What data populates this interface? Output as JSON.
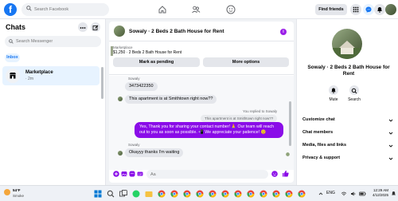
{
  "topbar": {
    "logo": "f",
    "search_placeholder": "Search Facebook",
    "find_friends": "Find friends"
  },
  "sidebar": {
    "title": "Chats",
    "search_placeholder": "Search Messenger",
    "inbox_label": "Inbox",
    "conversations": [
      {
        "name": "Marketplace",
        "time": "· 2m"
      }
    ]
  },
  "chat": {
    "title": "Sowaly · 2 Beds 2 Bath House for Rent",
    "info_icon": "i",
    "listing": {
      "label": "Marketplace",
      "description": "$1,250 · 2 Beds 2 Bath House for Rent",
      "mark_pending": "Mark as pending",
      "more_options": "More options"
    },
    "messages": {
      "sender1": "Sowaly",
      "msg1": "3473422350",
      "msg2": "This apartment is at Smithtown right now??",
      "reply_note": "You replied to Sowaly",
      "reply_quote": "This apartment is at Smithtown right now??",
      "outgoing": "Yes, Thank you for sharing your contact number! 🙏 Our team will reach out to you as soon as possible. 📲 We appreciate your patience! 😊",
      "sender2": "Sowaly",
      "msg3": "Okayyy thanks I'm waiting"
    },
    "composer_placeholder": "Aa"
  },
  "right_panel": {
    "name": "Sowaly · 2 Beds 2 Bath House for Rent",
    "mute": "Mute",
    "search": "Search",
    "sections": [
      "Customize chat",
      "Chat members",
      "Media, files and links",
      "Privacy & support"
    ]
  },
  "taskbar": {
    "temperature": "54°F",
    "weather": "Smoke",
    "time": "12:29 AM",
    "date": "4/12/2025",
    "lang": "ENG"
  },
  "colors": {
    "facebook_blue": "#1877f2",
    "messenger_purple": "#8a0ce8",
    "inbox_bg": "#e7f3ff"
  }
}
